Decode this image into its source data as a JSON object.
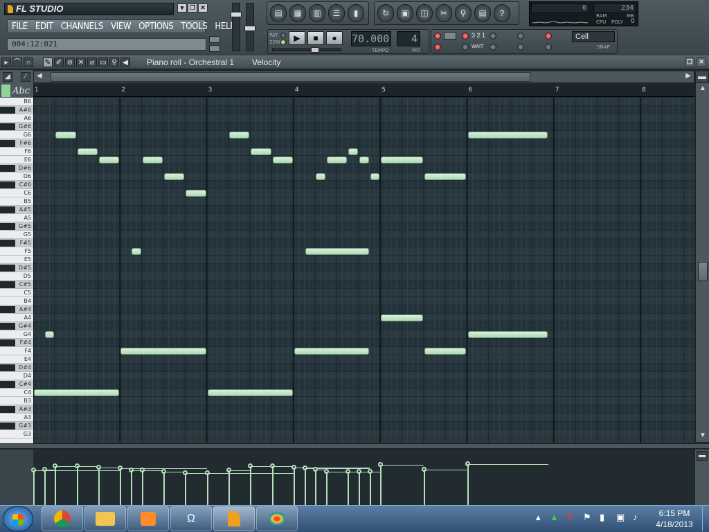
{
  "app": {
    "title": "FL STUDIO",
    "menus": [
      "FILE",
      "EDIT",
      "CHANNELS",
      "VIEW",
      "OPTIONS",
      "TOOLS",
      "HELP"
    ],
    "position": "004:12:021"
  },
  "window_buttons": [
    "▾",
    "❐",
    "✕"
  ],
  "toolbar": {
    "icons": [
      "playlist-icon",
      "step-sequencer-icon",
      "piano-roll-icon",
      "browser-icon",
      "mixer-icon",
      "undo-icon",
      "save-icon",
      "render-icon",
      "cut-icon",
      "zoom-icon",
      "notes-icon",
      "help-icon"
    ]
  },
  "monitor": {
    "value1": "6",
    "value2": "234",
    "ram_label": "RAM",
    "mb_label": "MB",
    "cpu_label": "CPU",
    "poly_label": "POLY",
    "poly": "0"
  },
  "transport": {
    "pat_label": "PAT",
    "song_label": "SONG",
    "tempo": "70.000",
    "tempo_label": "TEMPO",
    "pattern": "4",
    "pat2_label": "PAT"
  },
  "options": {
    "count": "3 2 1",
    "wait": "WAIT",
    "snap_value": "Cell",
    "snap_label": "SNAP"
  },
  "piano_roll": {
    "title": "Piano roll - Orchestral 1",
    "target": "Velocity",
    "abc": "Abc",
    "close": "✕",
    "restore": "❐"
  },
  "ruler": {
    "bars": [
      "1",
      "2",
      "3",
      "4",
      "5",
      "6",
      "7",
      "8"
    ]
  },
  "keys": [
    "B6",
    "A#6",
    "A6",
    "G#6",
    "G6",
    "F#6",
    "F6",
    "E6",
    "D#6",
    "D6",
    "C#6",
    "C6",
    "B5",
    "A#5",
    "A5",
    "G#5",
    "G5",
    "F#5",
    "F5",
    "E5",
    "D#5",
    "D5",
    "C#5",
    "C5",
    "B4",
    "A#4",
    "A4",
    "G#4",
    "G4",
    "F#4",
    "F4",
    "E4",
    "D#4",
    "D4",
    "C#4",
    "C4",
    "B3",
    "A#3",
    "A3",
    "G#3",
    "G3"
  ],
  "notes": [
    {
      "pitch": "C4",
      "start": 1.0,
      "len": 1.0
    },
    {
      "pitch": "G4",
      "start": 1.125,
      "len": 0.125
    },
    {
      "pitch": "G6",
      "start": 1.25,
      "len": 0.25
    },
    {
      "pitch": "F6",
      "start": 1.5,
      "len": 0.25
    },
    {
      "pitch": "E6",
      "start": 1.75,
      "len": 0.25
    },
    {
      "pitch": "F4",
      "start": 2.0,
      "len": 1.0
    },
    {
      "pitch": "F5",
      "start": 2.125,
      "len": 0.125
    },
    {
      "pitch": "E6",
      "start": 2.25,
      "len": 0.25
    },
    {
      "pitch": "D6",
      "start": 2.5,
      "len": 0.25
    },
    {
      "pitch": "C6",
      "start": 2.75,
      "len": 0.25
    },
    {
      "pitch": "C4",
      "start": 3.0,
      "len": 1.0
    },
    {
      "pitch": "G6",
      "start": 3.25,
      "len": 0.25
    },
    {
      "pitch": "F6",
      "start": 3.5,
      "len": 0.25
    },
    {
      "pitch": "E6",
      "start": 3.75,
      "len": 0.25
    },
    {
      "pitch": "F4",
      "start": 4.0,
      "len": 0.875
    },
    {
      "pitch": "F5",
      "start": 4.125,
      "len": 0.75
    },
    {
      "pitch": "D6",
      "start": 4.25,
      "len": 0.125
    },
    {
      "pitch": "E6",
      "start": 4.375,
      "len": 0.25
    },
    {
      "pitch": "F6",
      "start": 4.625,
      "len": 0.125
    },
    {
      "pitch": "E6",
      "start": 4.75,
      "len": 0.125
    },
    {
      "pitch": "D6",
      "start": 4.875,
      "len": 0.125
    },
    {
      "pitch": "E6",
      "start": 5.0,
      "len": 0.5
    },
    {
      "pitch": "A4",
      "start": 5.0,
      "len": 0.5
    },
    {
      "pitch": "D6",
      "start": 5.5,
      "len": 0.5
    },
    {
      "pitch": "F4",
      "start": 5.5,
      "len": 0.5
    },
    {
      "pitch": "G6",
      "start": 6.0,
      "len": 0.9375
    },
    {
      "pitch": "G4",
      "start": 6.0,
      "len": 0.9375
    }
  ],
  "velocities": [
    0.62,
    0.64,
    0.7,
    0.7,
    0.68,
    0.66,
    0.62,
    0.62,
    0.6,
    0.58,
    0.57,
    0.62,
    0.7,
    0.7,
    0.68,
    0.66,
    0.64,
    0.6,
    0.6,
    0.6,
    0.6,
    0.72,
    0.72,
    0.64,
    0.64,
    0.74,
    0.74
  ],
  "taskbar": {
    "apps": [
      "chrome-icon",
      "explorer-icon",
      "media-player-icon",
      "omega-icon",
      "fl-studio-icon",
      "paint-icon"
    ],
    "time": "6:15 PM",
    "date": "4/18/2013"
  }
}
